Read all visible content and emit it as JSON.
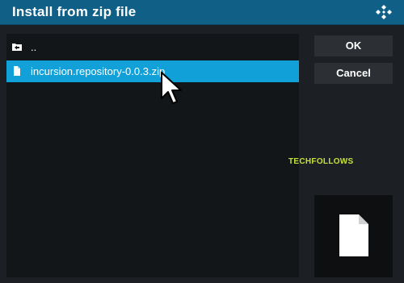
{
  "dialog": {
    "title": "Install from zip file"
  },
  "file_list": {
    "items": [
      {
        "label": "..",
        "icon": "folder-back-icon",
        "selected": false
      },
      {
        "label": "incursion.repository-0.0.3.zip",
        "icon": "file-icon",
        "selected": true
      }
    ]
  },
  "buttons": {
    "ok_label": "OK",
    "cancel_label": "Cancel"
  },
  "watermark": "TECHFOLLOWS",
  "preview": {
    "icon": "file-icon"
  },
  "colors": {
    "titlebar": "#0f5f86",
    "selection": "#12a0d8",
    "background": "#1a1d21",
    "watermark": "#c7e03a"
  }
}
